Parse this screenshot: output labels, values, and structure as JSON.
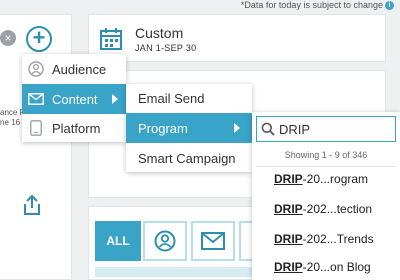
{
  "note": {
    "text": "*Data for today is subject to change",
    "icon": "info-icon"
  },
  "date_range": {
    "title": "Custom",
    "subtitle": "JAN 1-SEP 30"
  },
  "side_text": {
    "line1": "ance P",
    "line2": "ne 16"
  },
  "menu_level1": {
    "items": [
      {
        "label": "Audience",
        "icon": "person-icon"
      },
      {
        "label": "Content",
        "icon": "envelope-icon",
        "active": true
      },
      {
        "label": "Platform",
        "icon": "device-icon"
      }
    ]
  },
  "menu_level2": {
    "items": [
      {
        "label": "Email Send"
      },
      {
        "label": "Program",
        "active": true
      },
      {
        "label": "Smart Campaign"
      }
    ]
  },
  "search": {
    "value": "DRIP",
    "count_text": "Showing 1 - 9 of 346",
    "results": [
      {
        "bold": "DRIP",
        "rest": "-20...rogram"
      },
      {
        "bold": "DRIP",
        "rest": "-202...tection"
      },
      {
        "bold": "DRIP",
        "rest": "-202...Trends"
      },
      {
        "bold": "DRIP",
        "rest": "-20...on Blog"
      }
    ]
  },
  "toolbar": {
    "all_label": "ALL"
  },
  "colors": {
    "accent": "#3aa3c8",
    "accent_light": "#b7dcea",
    "background": "#eef0f2"
  }
}
